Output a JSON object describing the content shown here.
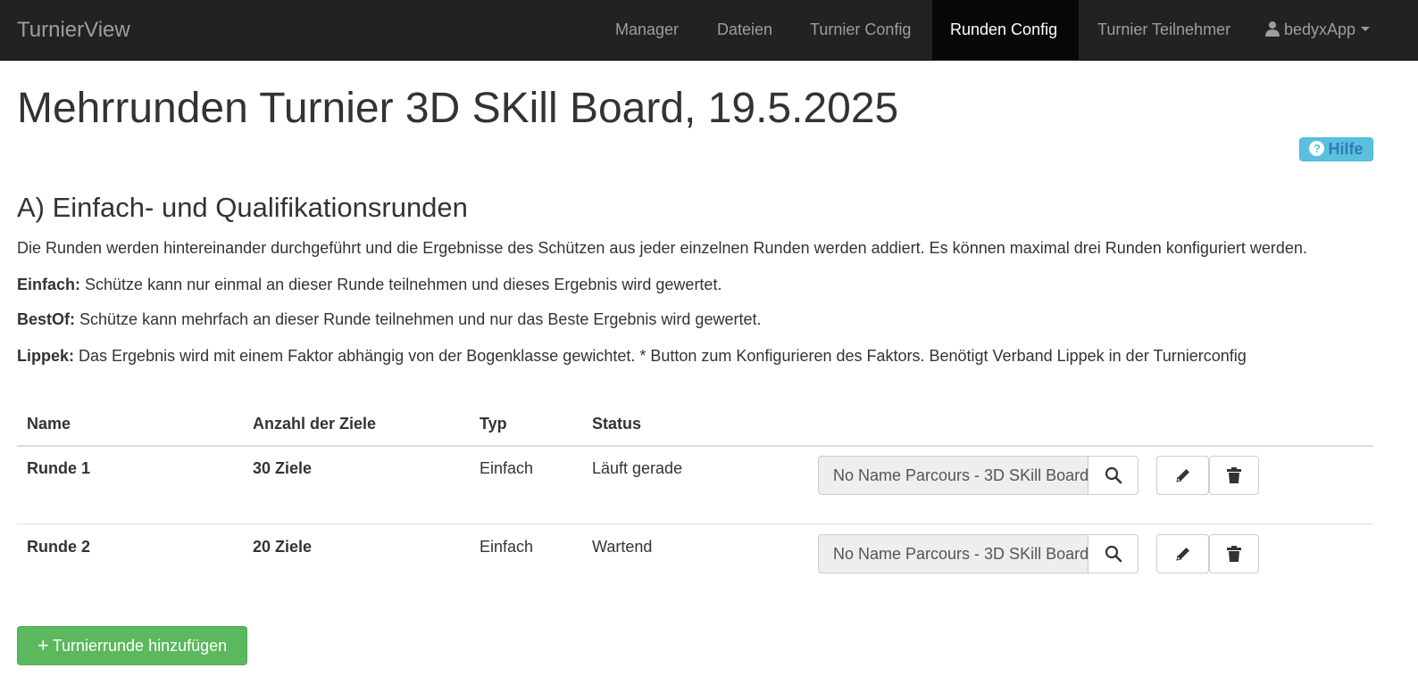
{
  "navbar": {
    "brand": "TurnierView",
    "items": [
      {
        "label": "Manager"
      },
      {
        "label": "Dateien"
      },
      {
        "label": "Turnier Config"
      },
      {
        "label": "Runden Config",
        "active": true
      },
      {
        "label": "Turnier Teilnehmer"
      }
    ],
    "user": "bedyxApp",
    "icons": {
      "user": "user-icon",
      "caret": "chevron-down-icon"
    }
  },
  "page": {
    "title": "Mehrrunden Turnier 3D SKill Board, 19.5.2025",
    "help_label": "Hilfe",
    "help_icon": "question-circle-icon"
  },
  "section": {
    "title": "A) Einfach- und Qualifikationsrunden",
    "intro": "Die Runden werden hintereinander durchgeführt und die Ergebnisse des Schützen aus jeder einzelnen Runden werden addiert. Es können maximal drei Runden konfiguriert werden.",
    "einfach_label": "Einfach:",
    "einfach_text": "Schütze kann nur einmal an dieser Runde teilnehmen und dieses Ergebnis wird gewertet.",
    "bestof_label": "BestOf:",
    "bestof_text": "Schütze kann mehrfach an dieser Runde teilnehmen und nur das Beste Ergebnis wird gewertet.",
    "lippek_label": "Lippek:",
    "lippek_text": "Das Ergebnis wird mit einem Faktor abhängig von der Bogenklasse gewichtet. * Button zum Konfigurieren des Faktors. Benötigt Verband Lippek in der Turnierconfig"
  },
  "table": {
    "headers": {
      "name": "Name",
      "targets": "Anzahl der Ziele",
      "type": "Typ",
      "status": "Status"
    },
    "rows": [
      {
        "name": "Runde 1",
        "targets": "30 Ziele",
        "type": "Einfach",
        "status": "Läuft gerade",
        "parcours": "No Name Parcours - 3D SKill Board"
      },
      {
        "name": "Runde 2",
        "targets": "20 Ziele",
        "type": "Einfach",
        "status": "Wartend",
        "parcours": "No Name Parcours - 3D SKill Board"
      }
    ],
    "icons": {
      "search": "search-icon",
      "edit": "pencil-icon",
      "delete": "trash-icon"
    }
  },
  "actions": {
    "add_round_label": "Turnierrunde hinzufügen",
    "add_icon": "plus-icon"
  },
  "colors": {
    "navbar_bg": "#222222",
    "nav_active_bg": "#080808",
    "help_bg": "#5bc0de",
    "add_btn_bg": "#5cb85c"
  }
}
